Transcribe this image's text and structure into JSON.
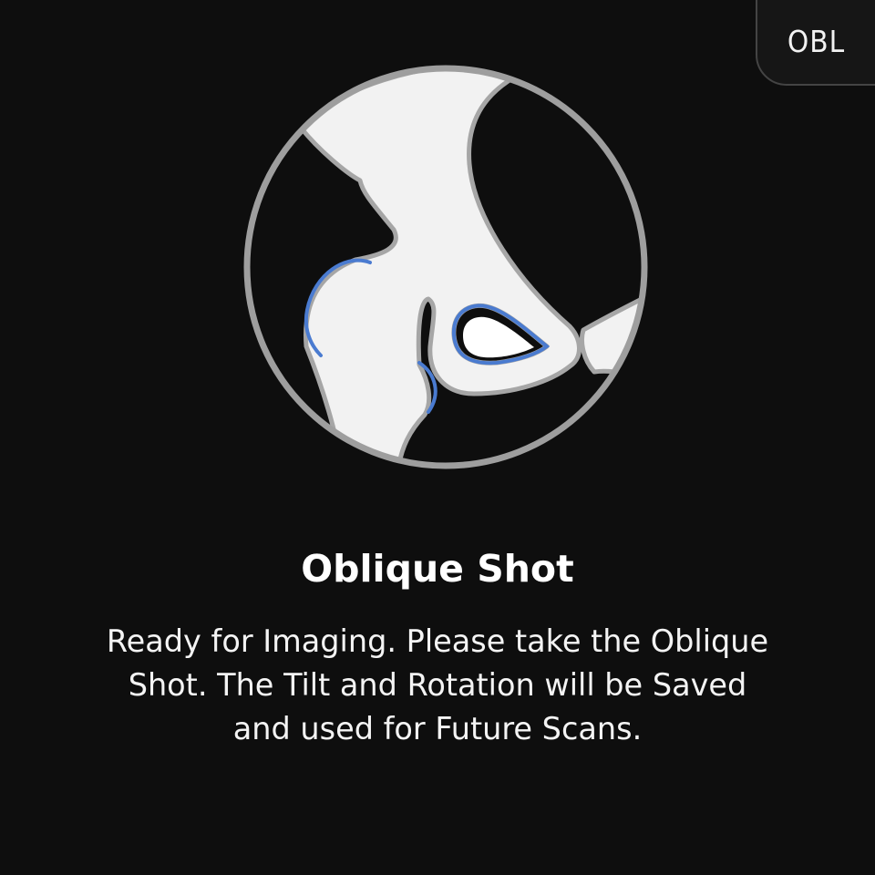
{
  "view_badge": {
    "label": "OBL"
  },
  "illustration": {
    "icon": "hip-joint-oblique-icon",
    "colors": {
      "background": "#0e0e0e",
      "bone_fill": "#f2f2f2",
      "bone_outline": "#a6a6a6",
      "ring": "#9e9e9e",
      "highlight": "#4a7bd0"
    }
  },
  "title": "Oblique Shot",
  "message": "Ready for Imaging. Please take the Oblique Shot. The Tilt and Rotation will be Saved and used for Future Scans."
}
